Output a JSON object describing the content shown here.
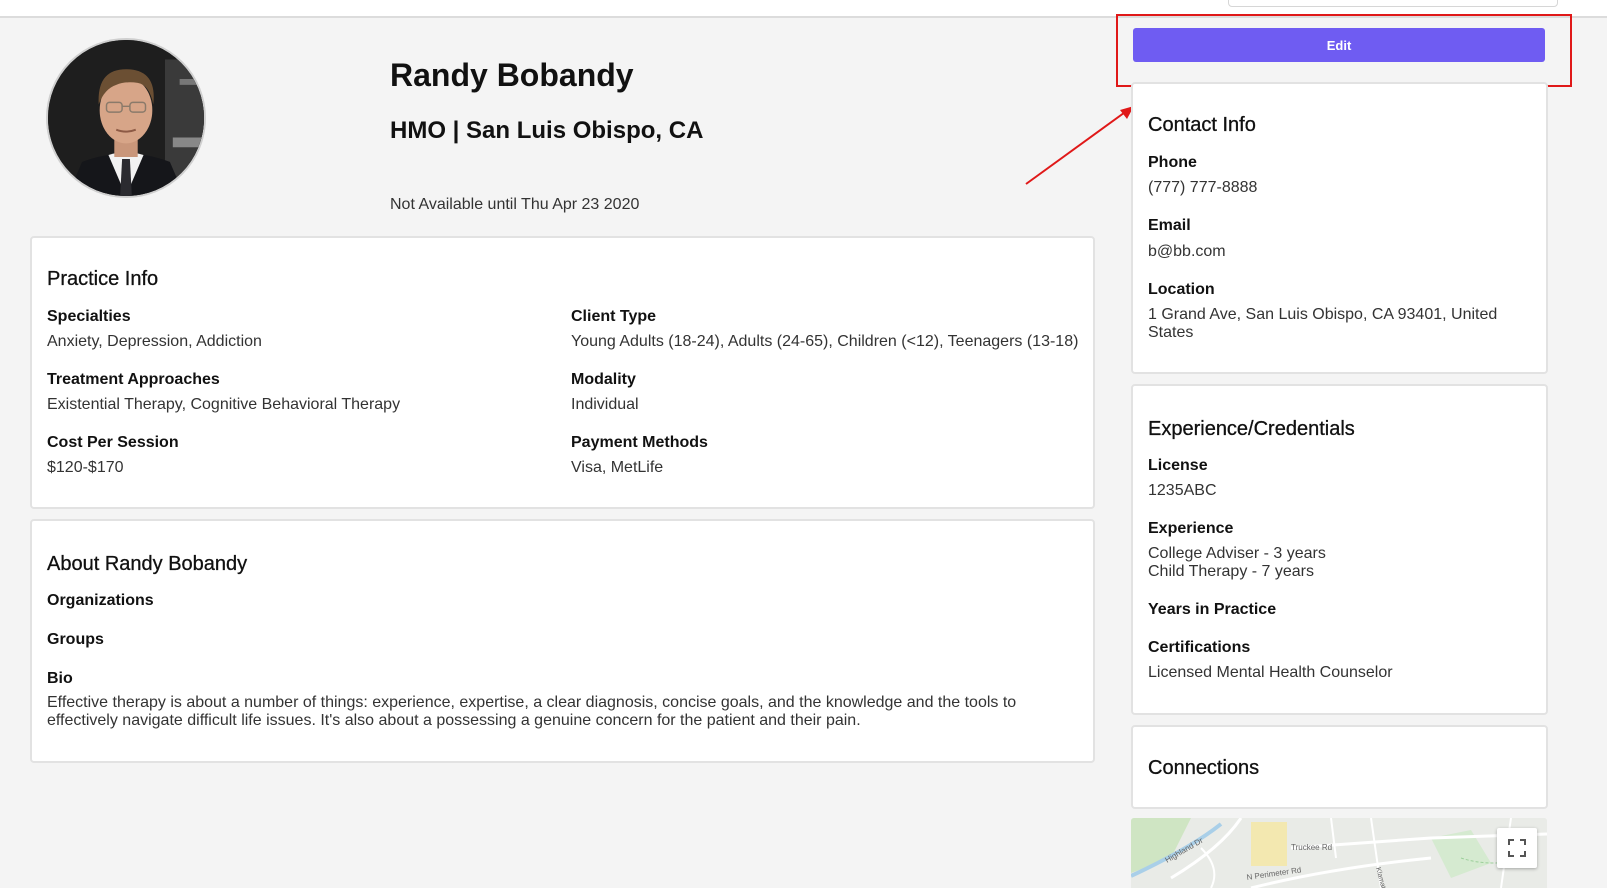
{
  "profile": {
    "name": "Randy Bobandy",
    "subtitle": "HMO | San Luis Obispo, CA",
    "availability": "Not Available until Thu Apr 23 2020"
  },
  "edit_button": {
    "label": "Edit"
  },
  "practice_info": {
    "title": "Practice Info",
    "specialties_label": "Specialties",
    "specialties_value": "Anxiety, Depression, Addiction",
    "treatment_label": "Treatment Approaches",
    "treatment_value": "Existential Therapy, Cognitive Behavioral Therapy",
    "cost_label": "Cost Per Session",
    "cost_value": "$120-$170",
    "client_type_label": "Client Type",
    "client_type_value": "Young Adults (18-24), Adults (24-65), Children (<12), Teenagers (13-18)",
    "modality_label": "Modality",
    "modality_value": "Individual",
    "payment_label": "Payment Methods",
    "payment_value": "Visa, MetLife"
  },
  "about": {
    "title": "About Randy Bobandy",
    "organizations_label": "Organizations",
    "groups_label": "Groups",
    "bio_label": "Bio",
    "bio_line1": "Effective therapy is about a number of things: experience, expertise, a clear diagnosis, concise goals, and the knowledge and the tools to",
    "bio_line2": "effectively navigate difficult life issues. It's also about a possessing a genuine concern for the patient and their pain."
  },
  "contact": {
    "title": "Contact Info",
    "phone_label": "Phone",
    "phone_value": "(777) 777-8888",
    "email_label": "Email",
    "email_value": "b@bb.com",
    "location_label": "Location",
    "location_line1": "1 Grand Ave, San Luis Obispo, CA 93401, United",
    "location_line2": "States"
  },
  "experience": {
    "title": "Experience/Credentials",
    "license_label": "License",
    "license_value": "1235ABC",
    "experience_label": "Experience",
    "experience_line1": "College Adviser - 3 years",
    "experience_line2": "Child Therapy - 7 years",
    "years_label": "Years in Practice",
    "certifications_label": "Certifications",
    "certifications_value": "Licensed Mental Health Counselor"
  },
  "connections": {
    "title": "Connections"
  },
  "map": {
    "road_labels": [
      "Highland Dr",
      "Truckee Rd",
      "N Perimeter Rd",
      "Klamath"
    ]
  },
  "icons": {
    "fullscreen": "fullscreen-icon"
  },
  "colors": {
    "accent": "#6f5cf2",
    "annotation": "#e01818"
  }
}
